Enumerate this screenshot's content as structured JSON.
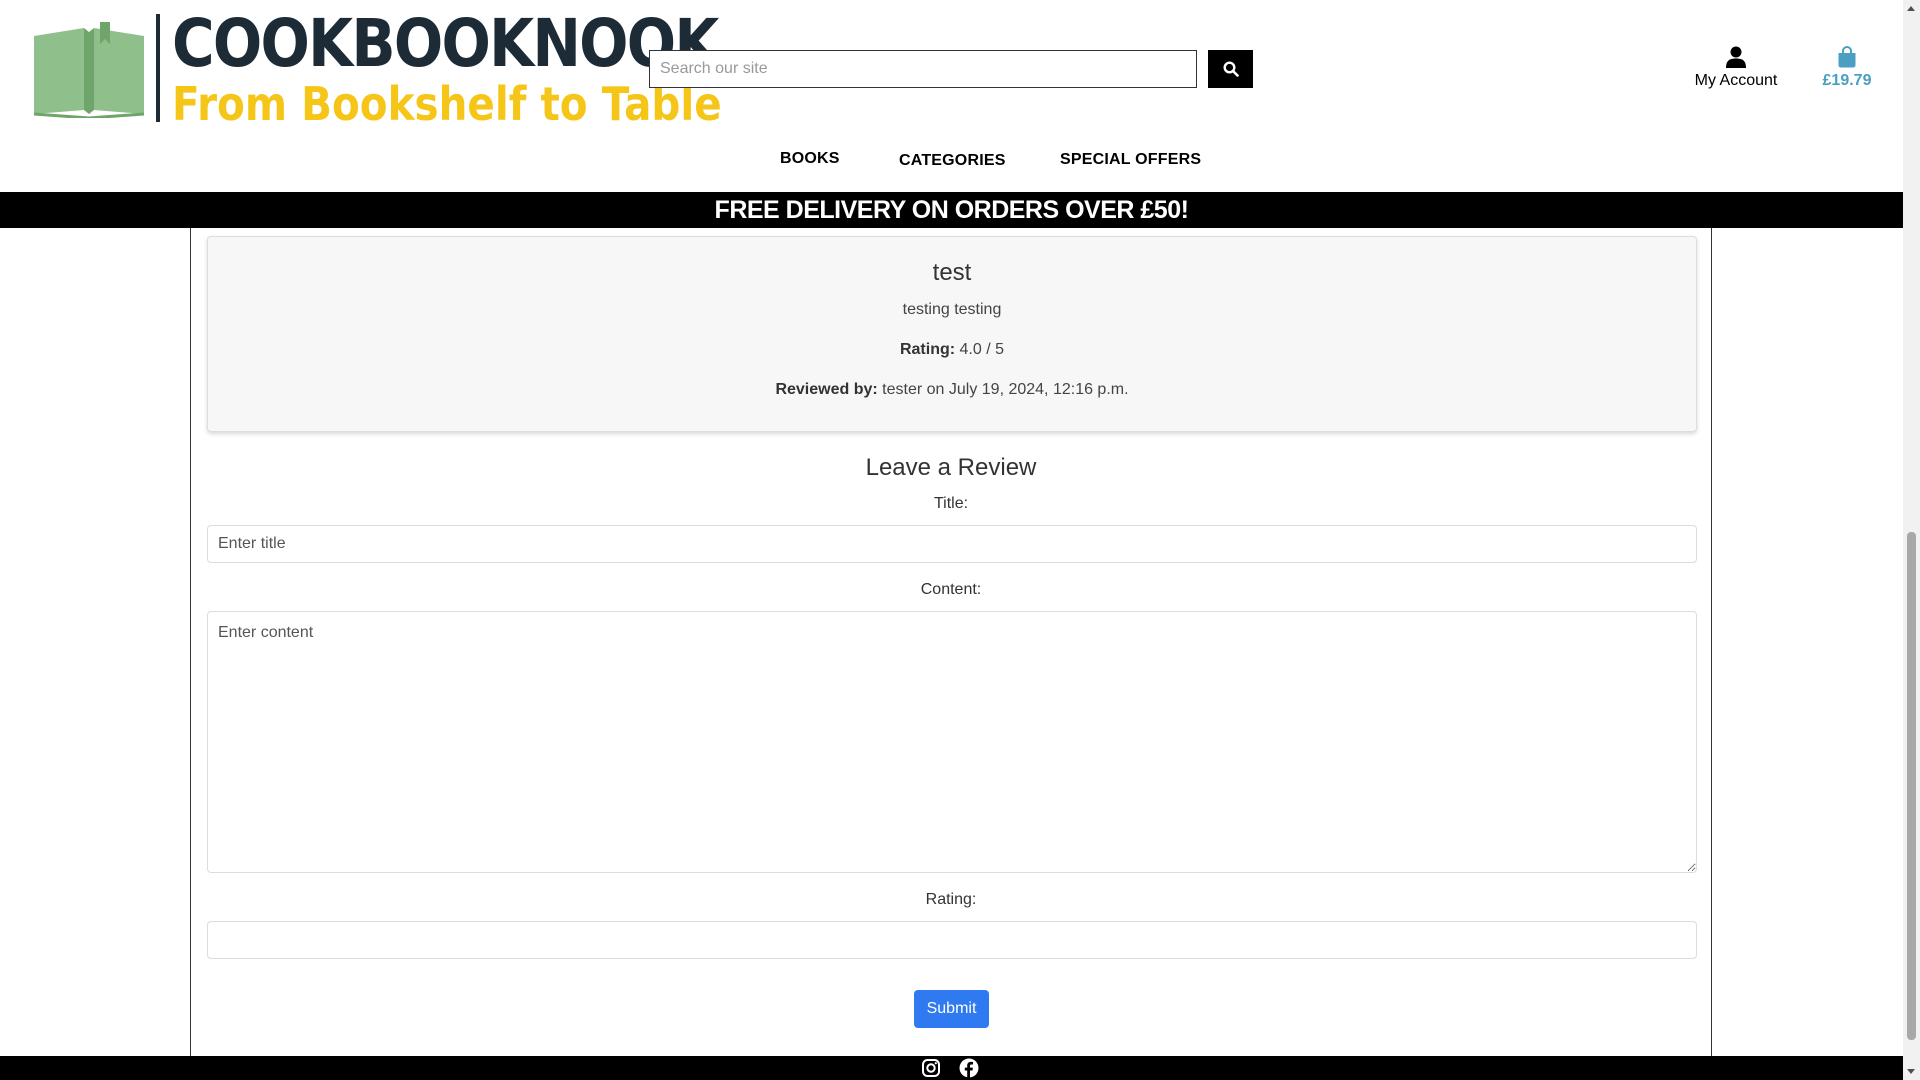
{
  "header": {
    "logo": {
      "brand": "COOKBOOKNOOK",
      "tagline": "From Bookshelf to Table"
    },
    "search": {
      "placeholder": "Search our site"
    },
    "account_label": "My Account",
    "cart_total": "£19.79"
  },
  "nav": [
    "BOOKS",
    "CATEGORIES",
    "SPECIAL OFFERS"
  ],
  "banner": "FREE DELIVERY ON ORDERS OVER £50!",
  "review": {
    "title": "test",
    "content": "testing testing",
    "rating_label": "Rating:",
    "rating_value": "4.0 / 5",
    "reviewed_by_label": "Reviewed by:",
    "reviewed_by_value": "tester on July 19, 2024, 12:16 p.m."
  },
  "form": {
    "heading": "Leave a Review",
    "title_label": "Title:",
    "title_placeholder": "Enter title",
    "content_label": "Content:",
    "content_placeholder": "Enter content",
    "rating_label": "Rating:",
    "submit_label": "Submit"
  },
  "footer": {
    "icons": [
      "instagram-icon",
      "facebook-icon"
    ]
  },
  "colors": {
    "logo_dark": "#1d2b36",
    "logo_yellow": "#f5c518",
    "logo_green": "#8fbf8a",
    "cart": "#4a9fc2",
    "submit": "#2f7af0"
  }
}
